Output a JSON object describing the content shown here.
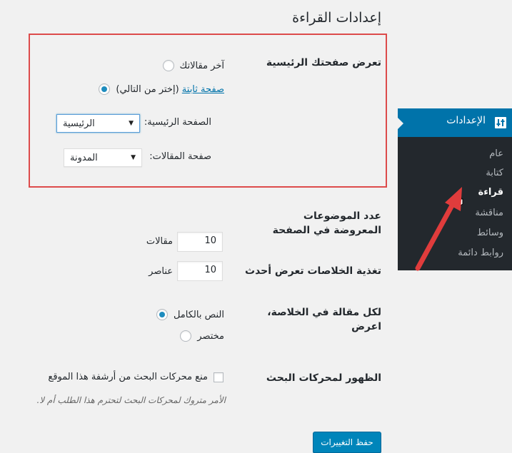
{
  "page_title": "إعدادات القراءة",
  "front_page": {
    "label": "تعرض صفحتك الرئيسية",
    "options": [
      {
        "label": "آخر مقالاتك",
        "selected": false
      },
      {
        "link": "صفحة ثابتة",
        "label_rest": "(إختر من التالي)",
        "selected": true
      }
    ],
    "homepage_label": "الصفحة الرئيسية:",
    "homepage_value": "الرئيسية",
    "posts_page_label": "صفحة المقالات:",
    "posts_page_value": "المدونة"
  },
  "posts_per_page": {
    "label": "عدد الموضوعات المعروضة في الصفحة",
    "value": "10",
    "suffix": "مقالات"
  },
  "feed_items": {
    "label": "تغذية الخلاصات تعرض أحدث",
    "value": "10",
    "suffix": "عناصر"
  },
  "feed_content": {
    "label": "لكل مقالة في الخلاصة، اعرض",
    "options": [
      {
        "label": "النص بالكامل",
        "selected": true
      },
      {
        "label": "مختصر",
        "selected": false
      }
    ]
  },
  "search_visibility": {
    "label": "الظهور لمحركات البحث",
    "checkbox_label": "منع محركات البحث من أرشفة هذا الموقع",
    "checked": false,
    "description": "الأمر متروك لمحركات البحث لتحترم هذا الطلب أم لا."
  },
  "save_button": "حفظ التغييرات",
  "admin_menu": {
    "title": "الإعدادات",
    "icon": "settings-sliders-icon",
    "items": [
      {
        "label": "عام",
        "current": false
      },
      {
        "label": "كتابة",
        "current": false
      },
      {
        "label": "قراءة",
        "current": true
      },
      {
        "label": "مناقشة",
        "current": false
      },
      {
        "label": "وسائط",
        "current": false
      },
      {
        "label": "روابط دائمة",
        "current": false
      }
    ]
  },
  "colors": {
    "accent": "#0073aa",
    "highlight_border": "#dd4b4b",
    "arrow": "#e03c3c",
    "menu_bg": "#23282d",
    "button": "#0085ba"
  }
}
